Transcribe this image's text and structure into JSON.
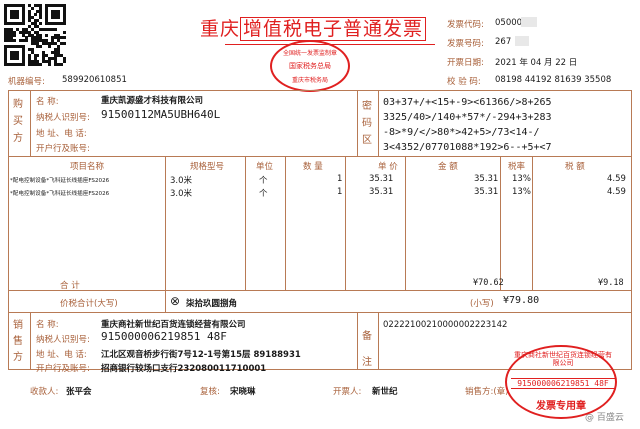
{
  "header": {
    "title_prefix": "重庆",
    "title_boxed": "增值税电子普通发票",
    "seal_top_text": "全国统一发票监制章",
    "seal_mid_text": "国家税务总局",
    "seal_bottom_text": "重庆市税务局"
  },
  "meta": {
    "machine_no_label": "机器编号:",
    "machine_no": "589920610851",
    "code_label": "发票代码:",
    "code": "05000",
    "number_label": "发票号码:",
    "number": "267",
    "date_label": "开票日期:",
    "date": "2021 年 04 月 22 日",
    "check_label": "校 验 码:",
    "check_code": "08198 44192 81639 35508"
  },
  "buyer": {
    "side_label": [
      "购",
      "买",
      "方"
    ],
    "name_label": "名 称:",
    "name": "重庆凯源盛才科技有限公司",
    "tax_id_label": "纳税人识别号:",
    "tax_id": "91500112MA5UBH640L",
    "address_label": "地 址、电 话:",
    "address": "",
    "bank_label": "开户行及账号:",
    "bank": ""
  },
  "cipher": {
    "side_label": [
      "密",
      "码",
      "区"
    ],
    "lines": [
      "03+37+/+<15+-9><61366/>8+265",
      "3325/40>/140+*57*/-294+3+283",
      "-8>*9/</>80*>42+5>/73<14-/",
      "3<4352/07701088*192>6--+5+<7"
    ]
  },
  "items": {
    "headers": [
      "项目名称",
      "规格型号",
      "单位",
      "数 量",
      "单 价",
      "金 额",
      "税率",
      "税 额"
    ],
    "rows": [
      [
        "*配电控制设备*飞科延长线插座FS2026",
        "3.0米",
        "个",
        "1",
        "35.31",
        "35.31",
        "13%",
        "4.59"
      ],
      [
        "*配电控制设备*飞科延长线插座FS2026",
        "3.0米",
        "个",
        "1",
        "35.31",
        "35.31",
        "13%",
        "4.59"
      ]
    ],
    "total_label": "合 计",
    "total_amount": "¥70.62",
    "total_tax": "¥9.18"
  },
  "grand_total": {
    "label": "价税合计(大写)",
    "circle_symbol": "⊗",
    "words": "柒拾玖圆捌角",
    "small_label": "(小写)",
    "small": "¥79.80"
  },
  "seller": {
    "side_label": [
      "销",
      "售",
      "方"
    ],
    "name_label": "名 称:",
    "name": "重庆商社新世纪百货连锁经营有限公司",
    "tax_id_label": "纳税人识别号:",
    "tax_id": "915000006219851 48F",
    "address_label": "地 址、电 话:",
    "address": "江北区观音桥步行街7号12-1号第15层 89188931",
    "bank_label": "开户行及账号:",
    "bank": "招商银行较场口支行232080011710001"
  },
  "remarks": {
    "side_label": [
      "备",
      "注"
    ],
    "text": "02222100210000002223142"
  },
  "footer": {
    "payee_label": "收款人:",
    "payee": "张平会",
    "reviewer_label": "复核:",
    "reviewer": "宋晓琳",
    "drawer_label": "开票人:",
    "drawer": "新世纪",
    "seller_label": "销售方:(章)"
  },
  "seller_seal": {
    "arc_text": "重庆商社新世纪百货连锁经营有限公司",
    "tax_id": "915000006219851 48F",
    "bottom_text": "发票专用章"
  },
  "watermark": "@ 百盛云"
}
